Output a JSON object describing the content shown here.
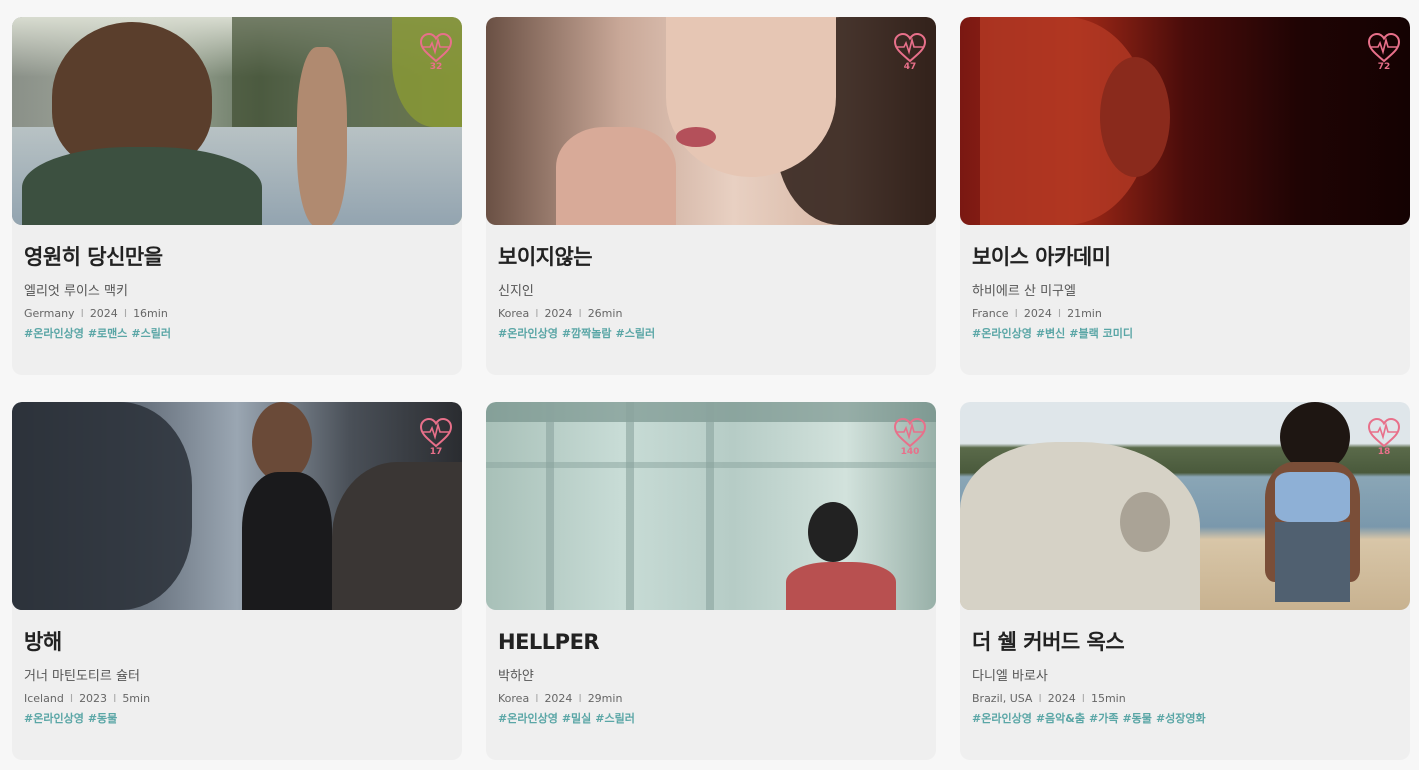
{
  "cards": [
    {
      "title": "영원히 당신만을",
      "director": "엘리엇 루이스 맥키",
      "country": "Germany",
      "year": "2024",
      "runtime": "16min",
      "tags": [
        "#온라인상영",
        "#로맨스",
        "#스릴러"
      ],
      "likes": "32"
    },
    {
      "title": "보이지않는",
      "director": "신지인",
      "country": "Korea",
      "year": "2024",
      "runtime": "26min",
      "tags": [
        "#온라인상영",
        "#깜짝놀람",
        "#스릴러"
      ],
      "likes": "47"
    },
    {
      "title": "보이스 아카데미",
      "director": "하비에르 산 미구엘",
      "country": "France",
      "year": "2024",
      "runtime": "21min",
      "tags": [
        "#온라인상영",
        "#변신",
        "#블랙 코미디"
      ],
      "likes": "72"
    },
    {
      "title": "방해",
      "director": "거너 마틴도티르 슐터",
      "country": "Iceland",
      "year": "2023",
      "runtime": "5min",
      "tags": [
        "#온라인상영",
        "#동물"
      ],
      "likes": "17"
    },
    {
      "title": "HELLPER",
      "director": "박하얀",
      "country": "Korea",
      "year": "2024",
      "runtime": "29min",
      "tags": [
        "#온라인상영",
        "#밀실",
        "#스릴러"
      ],
      "likes": "140"
    },
    {
      "title": "더 쉘 커버드 옥스",
      "director": "다니엘 바로사",
      "country": "Brazil, USA",
      "year": "2024",
      "runtime": "15min",
      "tags": [
        "#온라인상영",
        "#음악&춤",
        "#가족",
        "#동물",
        "#성장영화"
      ],
      "likes": "18"
    }
  ],
  "icons": {
    "like": "heart-pulse-icon"
  },
  "colors": {
    "like": "#e8708a",
    "tag": "#5aa6a6"
  }
}
